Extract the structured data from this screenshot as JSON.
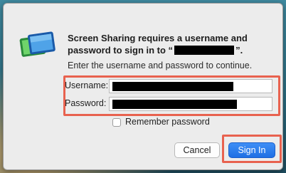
{
  "dialog": {
    "title_prefix": "Screen Sharing requires a username and password to sign in to “",
    "title_suffix": "”.",
    "subtitle": "Enter the username and password to continue.",
    "username_label": "Username:",
    "password_label": "Password:",
    "remember_label": "Remember password",
    "remember_checked": false,
    "cancel_label": "Cancel",
    "signin_label": "Sign In"
  },
  "icons": {
    "app": "screen-sharing-icon"
  },
  "colors": {
    "highlight": "#e8624f",
    "primary_button": "#1f6fe4"
  }
}
